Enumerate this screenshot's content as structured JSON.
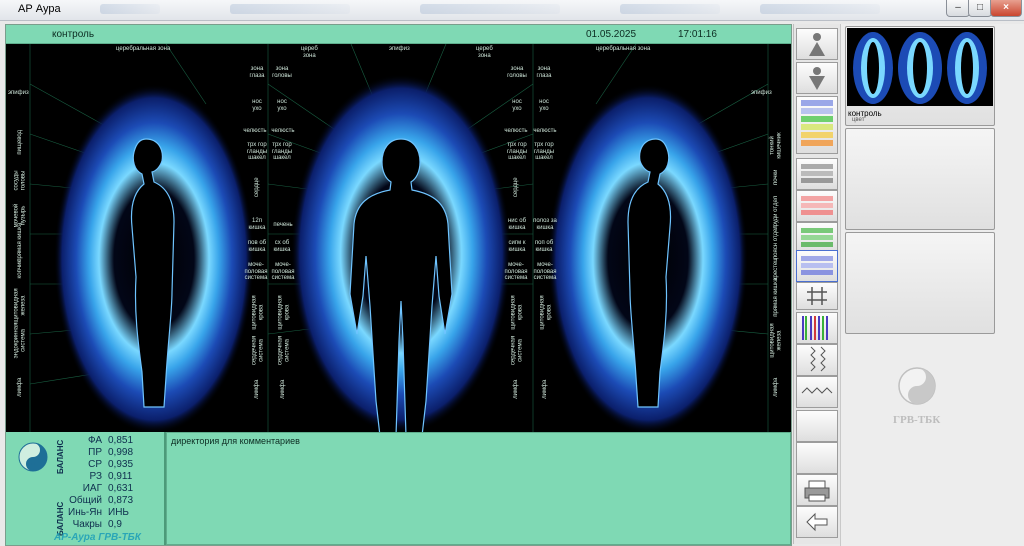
{
  "window": {
    "title": "АР Аура"
  },
  "header": {
    "label": "контроль",
    "date": "01.05.2025",
    "time": "17:01:16"
  },
  "zones": {
    "left_top": [
      "эпифиз",
      "церебральная зона"
    ],
    "left_side": [
      "пищевод",
      "сосуды головы",
      "мочевой пузырь",
      "прямая кишка",
      "копчик",
      "щитовидная железа",
      "эндокринная система",
      "лимфа"
    ],
    "mid_left_stack": [
      "зона\nглаза",
      "нос\nухо",
      "челюсть",
      "трх гор\nгланды\nшакел",
      "сердце",
      "12п\nкишка",
      "пов об\nкишка",
      "моче-\nполовая\nсистема",
      "щитовидная\nкрова",
      "сердечная\nсистема",
      "лимфа"
    ],
    "mid_right_stack": [
      "зона\nголовы",
      "нос\nухо",
      "челюсть",
      "трх гор\nгланды\nшакел",
      "печень",
      "сх об\nкишка",
      "моче-\nполовая\nсистема",
      "щитовидная\nкрова",
      "сердечная\nсистема",
      "лимфа"
    ],
    "center_top": [
      "цереб\nзона",
      "эпифиз",
      "цереб\nзона"
    ],
    "right_mid_left": [
      "зона\nголовы",
      "нос\nухо",
      "челюсть",
      "трх гор\nгланды\nшакел",
      "сердце",
      "нис об\nкишка",
      "сигм к\nкишка",
      "моче-\nполовая\nсистема",
      "щитовидная\nкрова",
      "сердечная\nсистема",
      "лимфа"
    ],
    "right_mid_right": [
      "зона\nглаза",
      "нос\nухо",
      "челюсть",
      "трх гор\nгланды\nшакел",
      "полоз за\nкишка",
      "поп об\nкишка",
      "моче-\nполовая\nсистема",
      "щитовидная\nкрова",
      "лимфа"
    ],
    "right_top": [
      "церебральная зона",
      "эпифиз"
    ],
    "right_side": [
      "тонкий кишечник",
      "почки",
      "груди отдел",
      "поясн отдел",
      "крестец",
      "прямая кишка",
      "щитовидная железа",
      "лимфа"
    ]
  },
  "metrics": {
    "balance_label": "БАЛАНС",
    "rows": [
      {
        "k": "ФА",
        "v": "0,851"
      },
      {
        "k": "ПР",
        "v": "0,998"
      },
      {
        "k": "СР",
        "v": "0,935"
      },
      {
        "k": "РЗ",
        "v": "0,911"
      },
      {
        "k": "ИАГ",
        "v": "0,631"
      },
      {
        "k": "Общий",
        "v": "0,873"
      },
      {
        "k": "Инь-Ян",
        "v": "ИНЬ"
      },
      {
        "k": "Чакры",
        "v": "0,9"
      }
    ],
    "brand": "АР-Аура ГРВ-ТБК"
  },
  "comment": {
    "label": "директория для комментариев"
  },
  "thumbnails": [
    {
      "label": "контроль",
      "sub": "цвет"
    }
  ],
  "logo_text": "ГРВ-ТБК",
  "icons": [
    "person-up-icon",
    "person-down-icon",
    "color-scale-icon",
    "gray-scale-icon",
    "red-scale-icon",
    "green-scale-icon",
    "blue-scale-icon",
    "grid-icon",
    "spectrum-icon",
    "waves-icon",
    "wave-icon",
    "print-icon",
    "back-arrow-icon"
  ],
  "colors": {
    "panel": "#7fd9b4",
    "aura_dark": "#000000",
    "aura_mid": "#1c4bb5",
    "aura_bright": "#7ad8ff",
    "text_dark": "#0f2f4e"
  }
}
